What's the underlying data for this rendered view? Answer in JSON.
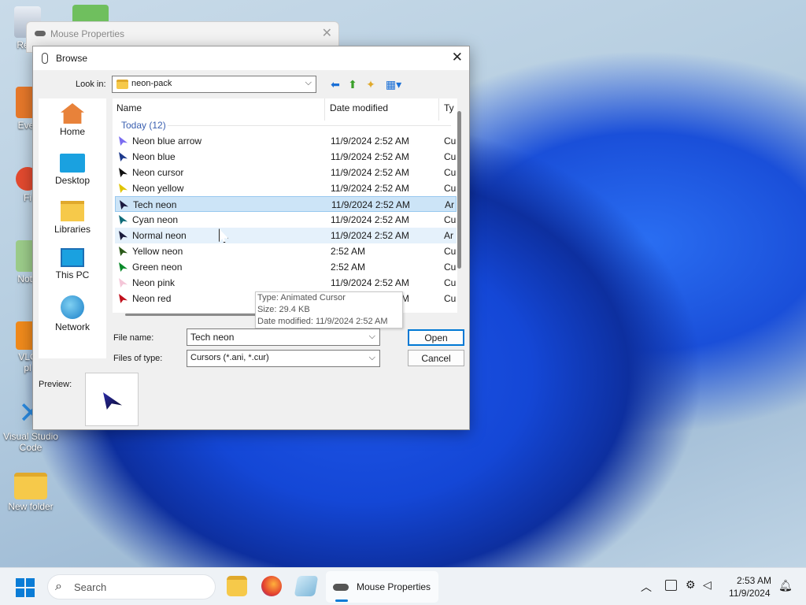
{
  "desktop_icons": [
    {
      "label": "Recy"
    },
    {
      "label": "Ever"
    },
    {
      "label": "Fi"
    },
    {
      "label": "Note"
    },
    {
      "label": "VLC"
    },
    {
      "label": "pl"
    },
    {
      "label": "Visual Studio Code"
    },
    {
      "label": "New folder"
    }
  ],
  "background_window": {
    "title": "Mouse Properties"
  },
  "dialog": {
    "title": "Browse",
    "look_in_label": "Look in:",
    "look_in_value": "neon-pack",
    "places": [
      {
        "label": "Home"
      },
      {
        "label": "Desktop"
      },
      {
        "label": "Libraries"
      },
      {
        "label": "This PC"
      },
      {
        "label": "Network"
      }
    ],
    "columns": {
      "name": "Name",
      "date": "Date modified",
      "type": "Ty"
    },
    "group_label": "Today (12)",
    "files": [
      {
        "name": "Neon blue arrow",
        "date": "11/9/2024 2:52 AM",
        "type": "Cu",
        "color": "#7a6cf0"
      },
      {
        "name": "Neon blue",
        "date": "11/9/2024 2:52 AM",
        "type": "Cu",
        "color": "#1d3a8c"
      },
      {
        "name": "Neon cursor",
        "date": "11/9/2024 2:52 AM",
        "type": "Cu",
        "color": "#111111"
      },
      {
        "name": "Neon yellow",
        "date": "11/9/2024 2:52 AM",
        "type": "Cu",
        "color": "#e0c400"
      },
      {
        "name": "Tech neon",
        "date": "11/9/2024 2:52 AM",
        "type": "Ar",
        "color": "#1a1a40"
      },
      {
        "name": "Cyan neon",
        "date": "11/9/2024 2:52 AM",
        "type": "Cu",
        "color": "#0f6b78"
      },
      {
        "name": "Normal neon",
        "date": "11/9/2024 2:52 AM",
        "type": "Ar",
        "color": "#1a1a3a"
      },
      {
        "name": "Yellow neon",
        "date": "2:52 AM",
        "type": "Cu",
        "color": "#2b5a1a"
      },
      {
        "name": "Green neon",
        "date": "2:52 AM",
        "type": "Cu",
        "color": "#0a8a2a"
      },
      {
        "name": "Neon pink",
        "date": "11/9/2024 2:52 AM",
        "type": "Cu",
        "color": "#f4c6d8"
      },
      {
        "name": "Neon red",
        "date": "11/9/2024 2:52 AM",
        "type": "Cu",
        "color": "#c0101c"
      }
    ],
    "tooltip": {
      "type": "Type: Animated Cursor",
      "size": "Size: 29.4 KB",
      "date": "Date modified: 11/9/2024 2:52 AM"
    },
    "file_name_label": "File name:",
    "file_name_value": "Tech neon",
    "file_type_label": "Files of type:",
    "file_type_value": "Cursors (*.ani, *.cur)",
    "open_label": "Open",
    "cancel_label": "Cancel",
    "preview_label": "Preview:"
  },
  "taskbar": {
    "search_placeholder": "Search",
    "active_app_label": "Mouse Properties",
    "time": "2:53 AM",
    "date": "11/9/2024"
  }
}
